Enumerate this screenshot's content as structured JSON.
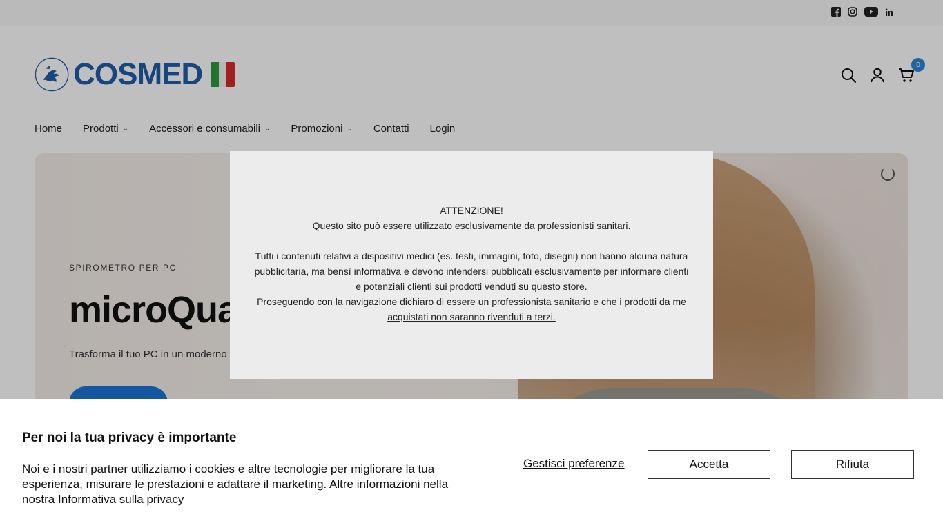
{
  "topbar": {
    "social": [
      "facebook-icon",
      "instagram-icon",
      "youtube-icon",
      "linkedin-icon"
    ]
  },
  "header": {
    "logo_text": "COSMED",
    "cart_count": "0"
  },
  "nav": {
    "items": [
      {
        "label": "Home",
        "has_dropdown": false
      },
      {
        "label": "Prodotti",
        "has_dropdown": true
      },
      {
        "label": "Accessori e consumabili",
        "has_dropdown": true
      },
      {
        "label": "Promozioni",
        "has_dropdown": true
      },
      {
        "label": "Contatti",
        "has_dropdown": false
      },
      {
        "label": "Login",
        "has_dropdown": false
      }
    ]
  },
  "hero": {
    "kicker": "SPIROMETRO PER PC",
    "title": "microQua",
    "subtitle": "Trasforma il tuo PC in un moderno"
  },
  "modal": {
    "heading": "ATTENZIONE!",
    "line1": "Questo sito può essere utilizzato esclusivamente da professionisti sanitari.",
    "body": "Tutti i contenuti relativi a dispositivi medici (es. testi, immagini, foto, disegni) non hanno alcuna natura pubblicitaria, ma bensì informativa e devono intendersi pubblicati esclusivamente per informare clienti e potenziali clienti sui prodotti venduti su questo store.",
    "link": "Proseguendo con la navigazione dichiaro di essere un professionista sanitario e che i prodotti da me acquistati non saranno rivenduti a terzi."
  },
  "cookie": {
    "title": "Per noi la tua privacy è importante",
    "text": "Noi e i nostri partner utilizziamo i cookies e altre tecnologie per migliorare la tua esperienza, misurare le prestazioni e adattare il marketing. Altre informazioni nella nostra",
    "policy_link": "Informativa sulla privacy",
    "manage_label": "Gestisci preferenze",
    "accept_label": "Accetta",
    "reject_label": "Rifiuta"
  },
  "colors": {
    "accent": "#2f86d6",
    "brand": "#1f5ea8",
    "hero_button": "#1b74d6"
  }
}
